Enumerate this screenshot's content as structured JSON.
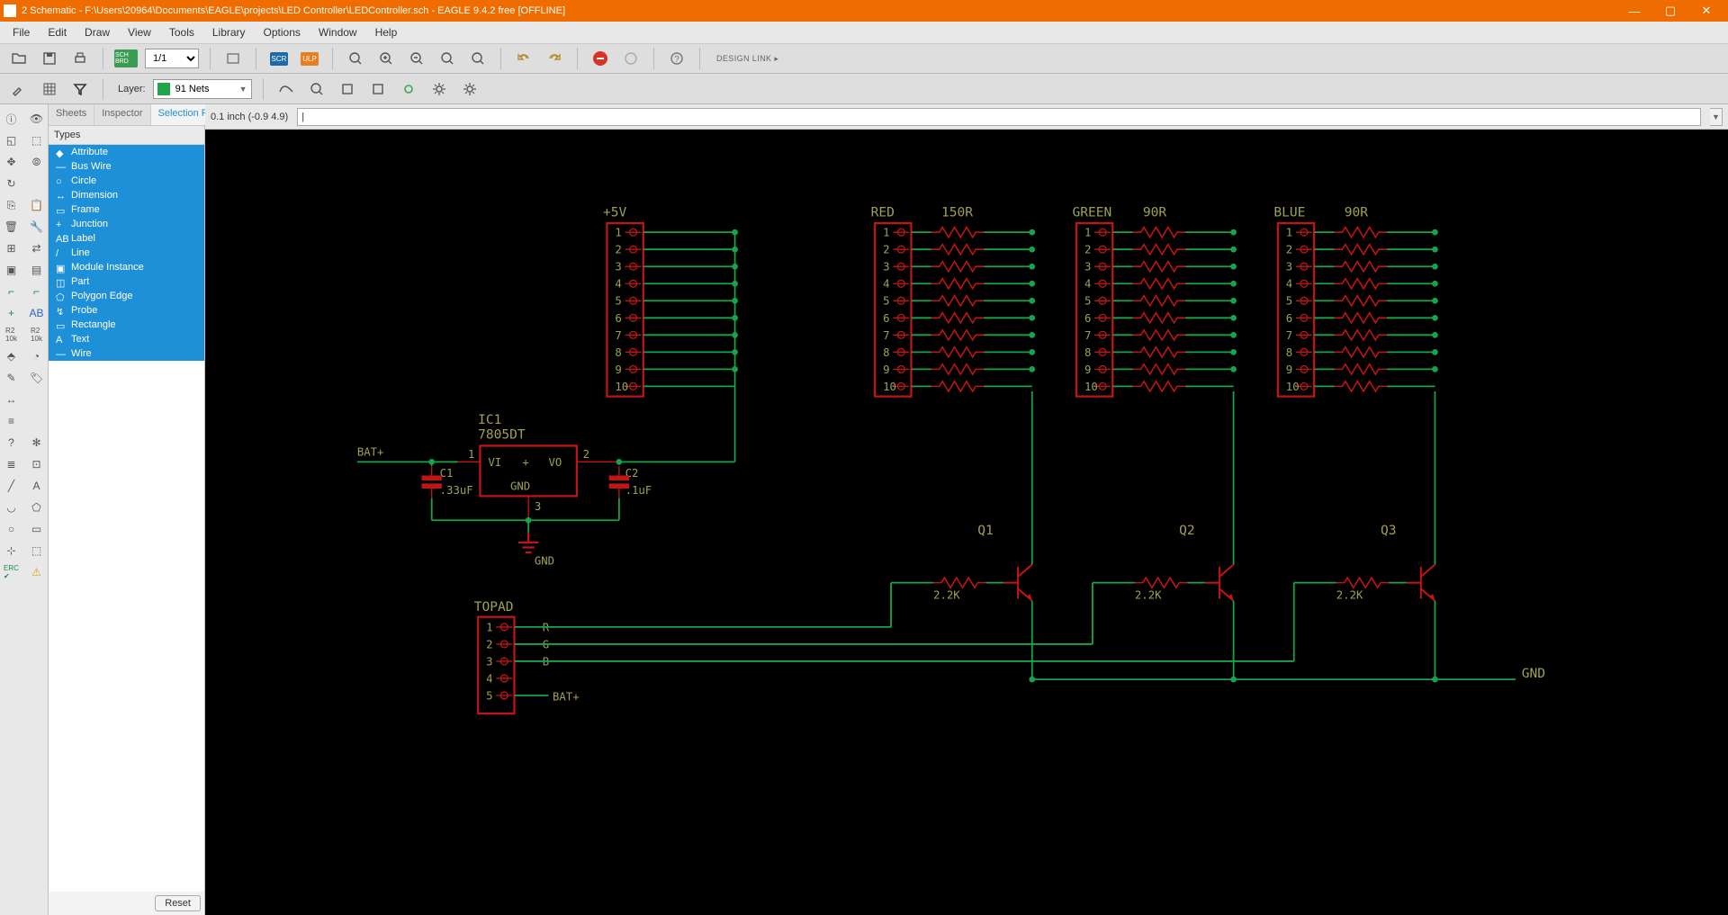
{
  "titlebar": {
    "title": "2 Schematic - F:\\Users\\20964\\Documents\\EAGLE\\projects\\LED Controller\\LEDController.sch - EAGLE 9.4.2 free [OFFLINE]"
  },
  "menu": {
    "items": [
      "File",
      "Edit",
      "Draw",
      "View",
      "Tools",
      "Library",
      "Options",
      "Window",
      "Help"
    ]
  },
  "toolbar": {
    "sheet": "1/1",
    "scr": "SCR",
    "ulp": "ULP",
    "sch": "SCH BRD",
    "designlink": "DESIGN LINK ▸"
  },
  "layer": {
    "label": "Layer:",
    "value": "91 Nets"
  },
  "sidepanel": {
    "tabs": [
      "Sheets",
      "Inspector",
      "Selection Filter"
    ],
    "active_tab": 2,
    "types_header": "Types",
    "types": [
      "Attribute",
      "Bus Wire",
      "Circle",
      "Dimension",
      "Frame",
      "Junction",
      "Label",
      "Line",
      "Module Instance",
      "Part",
      "Polygon Edge",
      "Probe",
      "Rectangle",
      "Text",
      "Wire"
    ],
    "reset": "Reset"
  },
  "coordbar": {
    "text": "0.1 inch (-0.9 4.9)"
  },
  "schematic": {
    "labels": {
      "plus5v": "+5V",
      "red": "RED",
      "green": "GREEN",
      "blue": "BLUE",
      "r150": "150R",
      "r90a": "90R",
      "r90b": "90R",
      "ic1": "IC1",
      "ic1_part": "7805DT",
      "vi": "VI",
      "vo": "VO",
      "gnd_text": "GND",
      "c1": "C1",
      "c1_val": ".33uF",
      "c2": "C2",
      "c2_val": ".1uF",
      "batplus": "BAT+",
      "gnd_big": "GND",
      "topad": "TOPAD",
      "r": "R",
      "g": "G",
      "b": "B",
      "batpad": "BAT+",
      "q1": "Q1",
      "q2": "Q2",
      "q3": "Q3",
      "r22k": "2.2K",
      "gnd_right": "GND",
      "pin_nums": [
        "1",
        "2",
        "3",
        "4",
        "5",
        "6",
        "7",
        "8",
        "9",
        "10"
      ],
      "pad_nums": [
        "1",
        "2",
        "3",
        "4",
        "5"
      ],
      "ic_pin1": "1",
      "ic_pin2": "2",
      "ic_pin3": "3"
    }
  }
}
